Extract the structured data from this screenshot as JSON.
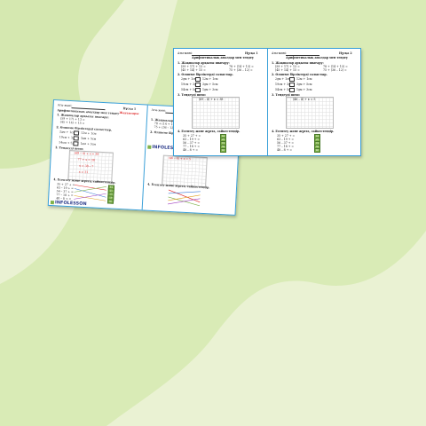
{
  "colors": {
    "background": "#eaf2d3",
    "blob": "#d5e8b0",
    "border": "#3aa0d8",
    "answers": "#d22222"
  },
  "worksheet": {
    "name_label": "Аты-жөні:",
    "variant1": "Нұсқа 1",
    "variant2": "Нұсқа 2",
    "title": "Арифметикалық амалдар мен теңдеу",
    "answers_label": "Жауаптары",
    "task1": "1. Жақшалар арқылы шығару:",
    "task1_items": [
      "(59 + 17) + 13 =",
      "(45 + 14) + 15 =",
      "78 + (14 + 13) =",
      "75 + (36 – 12) ="
    ],
    "task2": "2. Өлшеме бірліктерді салыстыр.",
    "task2_items": [
      "2дм + 1см",
      "12м + 1см",
      "19см + 3дм",
      "3дм + 5см",
      "54см + 5дм",
      "1дм + 3см"
    ],
    "task3": "3. Теңдеуді шеш:",
    "equation1": "(69 – 4) + x = 38",
    "equation2": "(46 – 4) + x = 5",
    "answer_line1": "77 + x = 38",
    "answer_line2": "x = 38 – 7",
    "answer_line3": "x = 31",
    "task4": "4. Есептеу және жұпта, сайкестендір.",
    "task4_items": [
      "35 + 27 + =",
      "63 – 19 + =",
      "56 – 37 + =",
      "77 – 18 + =",
      "48 – 8 + ="
    ],
    "task4_results": [
      "44",
      "25",
      "19",
      "59",
      "40"
    ],
    "logo": "INFOLESSON"
  }
}
